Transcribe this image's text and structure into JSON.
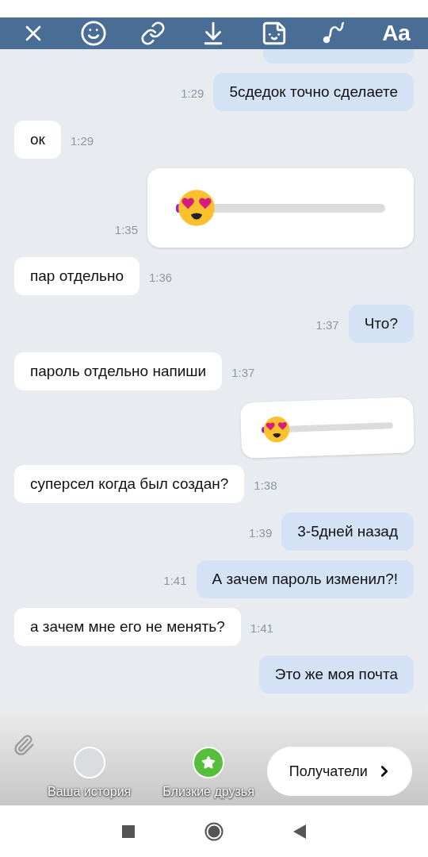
{
  "toolbar": {
    "text_button": "Aa"
  },
  "messages": [
    {
      "kind": "outgoing-stub"
    },
    {
      "kind": "outgoing",
      "text": "5сдедок точно сделаете",
      "time": "1:29"
    },
    {
      "kind": "incoming",
      "text": "ок",
      "time": "1:29"
    },
    {
      "kind": "slider",
      "time": "1:35"
    },
    {
      "kind": "incoming",
      "text": "пар отдельно",
      "time": "1:36"
    },
    {
      "kind": "outgoing",
      "text": "Что?",
      "time": "1:37"
    },
    {
      "kind": "incoming",
      "text": "пароль отдельно напиши",
      "time": "1:37"
    },
    {
      "kind": "mini-slider"
    },
    {
      "kind": "incoming",
      "text": "суперсел когда был создан?",
      "time": "1:38"
    },
    {
      "kind": "outgoing",
      "text": "3-5дней назад",
      "time": "1:39"
    },
    {
      "kind": "outgoing",
      "text": "А зачем пароль изменил?!",
      "time": "1:41"
    },
    {
      "kind": "incoming",
      "text": "а зачем мне его не менять?",
      "time": "1:41"
    },
    {
      "kind": "outgoing",
      "text": "Это же моя почта"
    }
  ],
  "story_panel": {
    "options": [
      {
        "kind": "avatar",
        "label": "Ваша история"
      },
      {
        "kind": "star",
        "label": "Близкие друзья"
      }
    ],
    "recipients_button": "Получатели"
  }
}
